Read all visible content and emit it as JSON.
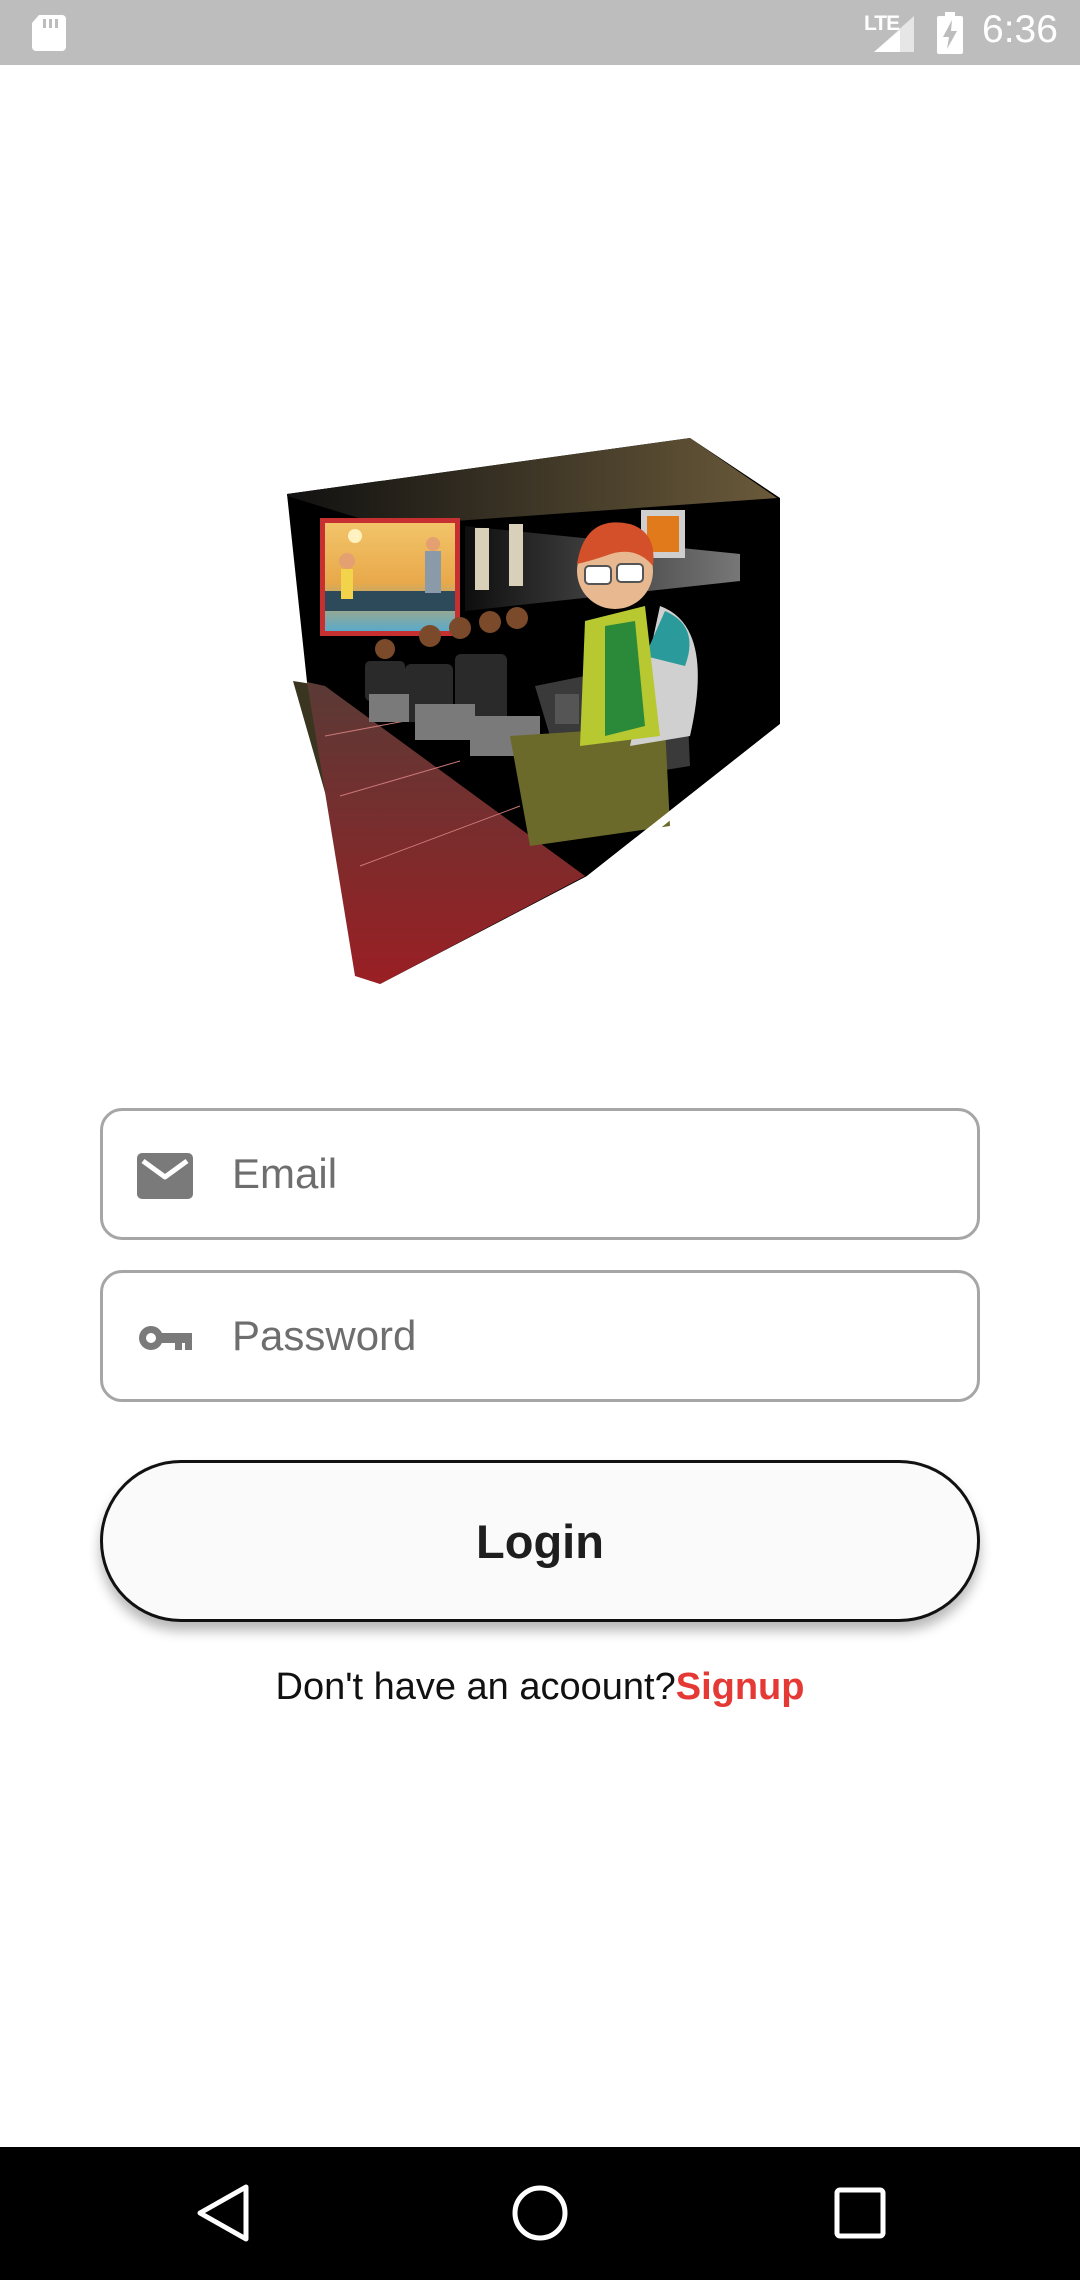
{
  "status_bar": {
    "time": "6:36",
    "network": "LTE",
    "icons": [
      "sd-card-icon",
      "signal-icon",
      "battery-charging-icon"
    ]
  },
  "hero": {
    "icon": "movie-theater-illustration"
  },
  "form": {
    "email_placeholder": "Email",
    "email_value": "",
    "email_icon": "email-icon",
    "password_placeholder": "Password",
    "password_value": "",
    "password_icon": "key-icon"
  },
  "login_button": {
    "label": "Login"
  },
  "signup": {
    "prompt": "Don't have an acoount?",
    "link_label": "Signup",
    "link_color": "#e53935"
  },
  "nav_bar": {
    "icons": [
      "back-icon",
      "home-icon",
      "recents-icon"
    ]
  }
}
